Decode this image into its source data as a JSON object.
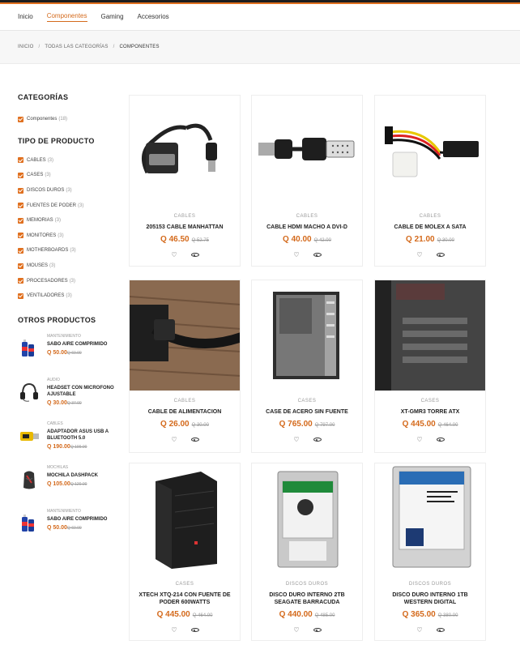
{
  "nav": {
    "items": [
      {
        "label": "Inicio"
      },
      {
        "label": "Componentes"
      },
      {
        "label": "Gaming"
      },
      {
        "label": "Accesorios"
      }
    ]
  },
  "breadcrumb": {
    "items": [
      "INICIO",
      "TODAS LAS CATEGORÍAS",
      "COMPONENTES"
    ],
    "separator": "/"
  },
  "sidebar": {
    "categories_title": "CATEGORÍAS",
    "categories": [
      {
        "label": "Componentes",
        "count": "(18)"
      }
    ],
    "types_title": "TIPO DE PRODUCTO",
    "types": [
      {
        "label": "CABLES",
        "count": "(3)"
      },
      {
        "label": "CASES",
        "count": "(3)"
      },
      {
        "label": "DISCOS DUROS",
        "count": "(3)"
      },
      {
        "label": "FUENTES DE PODER",
        "count": "(3)"
      },
      {
        "label": "MEMORIAS",
        "count": "(3)"
      },
      {
        "label": "MONITORES",
        "count": "(3)"
      },
      {
        "label": "MOTHERBOARDS",
        "count": "(3)"
      },
      {
        "label": "MOUSES",
        "count": "(3)"
      },
      {
        "label": "PROCESADORES",
        "count": "(3)"
      },
      {
        "label": "VENTILADORES",
        "count": "(3)"
      }
    ],
    "other_title": "OTROS PRODUCTOS",
    "other": [
      {
        "cat": "MANTENIMIENTO",
        "name": "SABO AIRE COMPRIMIDO",
        "price": "Q 50.00",
        "old": "Q 60.00",
        "icon": "air-can-icon"
      },
      {
        "cat": "AUDIO",
        "name": "HEADSET CON MICROFONO AJUSTABLE",
        "price": "Q 30.00",
        "old": "Q 37.00",
        "icon": "headset-icon"
      },
      {
        "cat": "CABLES",
        "name": "ADAPTADOR ASUS USB A BLUETOOTH 5.0",
        "price": "Q 190.00",
        "old": "Q 199.00",
        "icon": "usb-adapter-icon"
      },
      {
        "cat": "MOCHILAS",
        "name": "MOCHILA DASHPACK",
        "price": "Q 105.00",
        "old": "Q 120.00",
        "icon": "backpack-icon"
      },
      {
        "cat": "MANTENIMIENTO",
        "name": "SABO AIRE COMPRIMIDO",
        "price": "Q 50.00",
        "old": "Q 60.00",
        "icon": "air-can-icon"
      }
    ]
  },
  "products": [
    {
      "cat": "CABLES",
      "name": "205153 CABLE MANHATTAN",
      "price": "Q 46.50",
      "old": "Q 52.75"
    },
    {
      "cat": "CABLES",
      "name": "CABLE HDMI MACHO A DVI-D",
      "price": "Q 40.00",
      "old": "Q 42.00"
    },
    {
      "cat": "CABLES",
      "name": "CABLE DE MOLEX A SATA",
      "price": "Q 21.00",
      "old": "Q 30.00"
    },
    {
      "cat": "CABLES",
      "name": "CABLE DE ALIMENTACION",
      "price": "Q 26.00",
      "old": "Q 30.00"
    },
    {
      "cat": "CASES",
      "name": "CASE DE ACERO SIN FUENTE",
      "price": "Q 765.00",
      "old": "Q 797.00"
    },
    {
      "cat": "CASES",
      "name": "XT-GMR3 TORRE ATX",
      "price": "Q 445.00",
      "old": "Q 464.00"
    },
    {
      "cat": "CASES",
      "name": "XTECH XTQ-214 CON FUENTE DE PODER 600WATTS",
      "price": "Q 445.00",
      "old": "Q 464.00"
    },
    {
      "cat": "DISCOS DUROS",
      "name": "DISCO DURO INTERNO 2TB SEAGATE BARRACUDA",
      "price": "Q 440.00",
      "old": "Q 485.00"
    },
    {
      "cat": "DISCOS DUROS",
      "name": "DISCO DURO INTERNO 1TB WESTERN DIGITAL",
      "price": "Q 365.00",
      "old": "Q 380.00"
    }
  ],
  "colors": {
    "accent": "#d46a1c",
    "checkbox": "#e0701f"
  }
}
